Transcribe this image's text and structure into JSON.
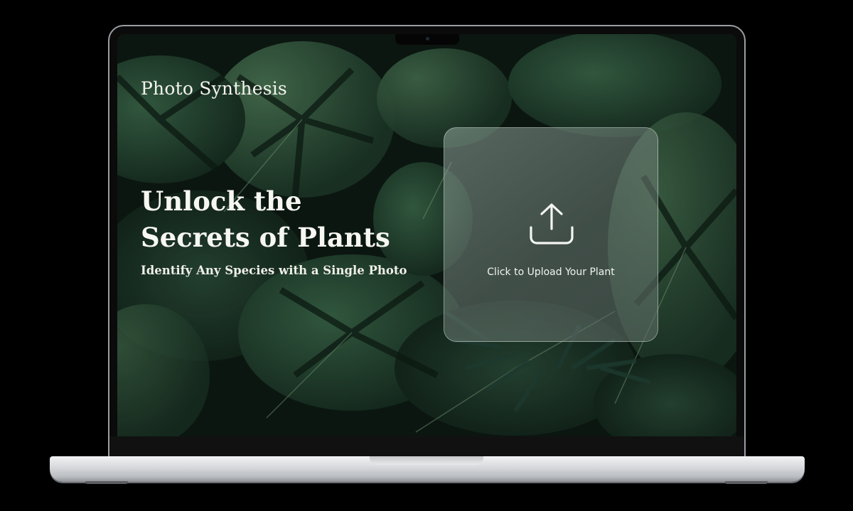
{
  "app": {
    "brand": "Photo Synthesis"
  },
  "hero": {
    "headline_line1": "Unlock the",
    "headline_line2": "Secrets of Plants",
    "subheadline": "Identify Any Species with a Single Photo"
  },
  "upload": {
    "label": "Click to Upload Your Plant",
    "icon": "upload-icon"
  },
  "colors": {
    "background_leaf_dark": "#12261c",
    "background_leaf_mid": "#2f5a3e",
    "text": "#f7f7f2",
    "device_silver": "#d9dbde"
  }
}
